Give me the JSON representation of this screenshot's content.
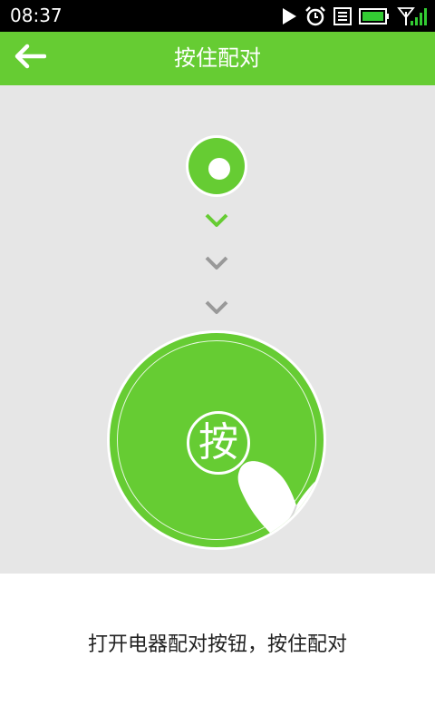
{
  "status_bar": {
    "time": "08:37",
    "icons": [
      "play-icon",
      "alarm-icon",
      "notification-icon",
      "battery-icon",
      "signal-icon"
    ]
  },
  "header": {
    "back_icon": "arrow-left-icon",
    "title": "按住配对"
  },
  "illustration": {
    "press_label": "按"
  },
  "instruction": "打开电器配对按钮，按住配对",
  "colors": {
    "accent": "#66cc33",
    "background": "#e6e6e6",
    "chevron_inactive": "#999999"
  }
}
